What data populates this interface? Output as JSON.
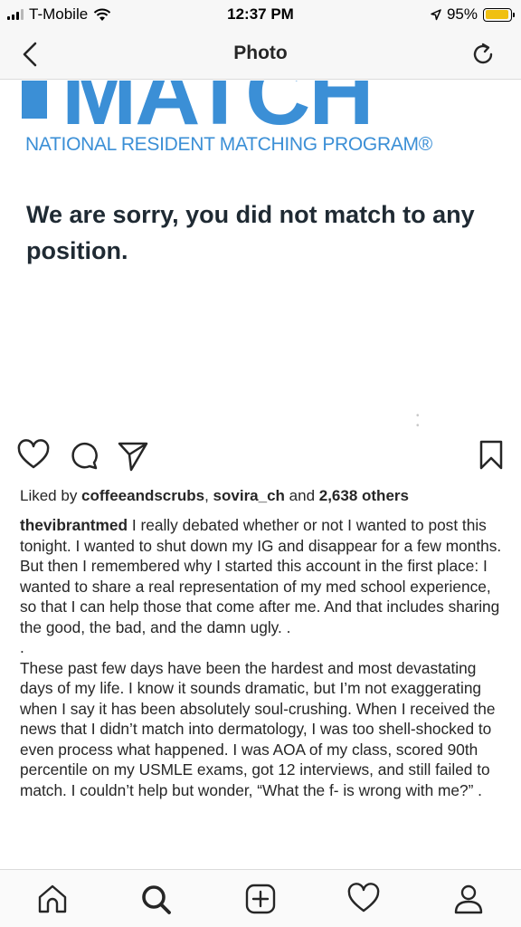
{
  "status_bar": {
    "carrier": "T-Mobile",
    "time": "12:37 PM",
    "battery": "95%",
    "battery_level": 0.95
  },
  "nav": {
    "title": "Photo",
    "back_icon": "chevron-left-icon",
    "refresh_icon": "refresh-icon"
  },
  "post_image": {
    "logo_word": "MATCH",
    "logo_subtitle": "NATIONAL RESIDENT MATCHING PROGRAM®",
    "message": "We are sorry, you did not match to any position."
  },
  "actions": {
    "like_icon": "heart-icon",
    "comment_icon": "comment-icon",
    "share_icon": "paper-plane-icon",
    "save_icon": "bookmark-icon"
  },
  "likes": {
    "prefix": "Liked by ",
    "user1": "coffeeandscrubs",
    "sep": ", ",
    "user2": "sovira_ch",
    "and": " and ",
    "others": "2,638 others"
  },
  "caption": {
    "username": "thevibrantmed",
    "para1": " I really debated whether or not I wanted to post this tonight. I wanted to shut down my IG and disappear for a few months. But then I remembered why I started this account in the first place: I wanted to share a real representation of my med school experience, so that I can help those that come after me. And that includes sharing the good, the bad, and the damn ugly. .",
    "dot": ".",
    "para2": "These past few days have been the hardest and most devastating days of my life. I know it sounds dramatic, but I’m not exaggerating when I say it has been absolutely soul-crushing. When I received the news that I didn’t match into dermatology, I was too shell-shocked to even process what happened. I was AOA of my class, scored 90th percentile on my USMLE exams, got 12 interviews, and still failed to match. I couldn’t help but wonder, “What the f- is wrong with me?” ."
  },
  "tab_bar": {
    "items": [
      "home-icon",
      "search-icon",
      "new-post-icon",
      "activity-icon",
      "profile-icon"
    ]
  },
  "colors": {
    "brand_blue": "#3b8fd6",
    "battery_yellow": "#f0c012",
    "text": "#262626"
  }
}
